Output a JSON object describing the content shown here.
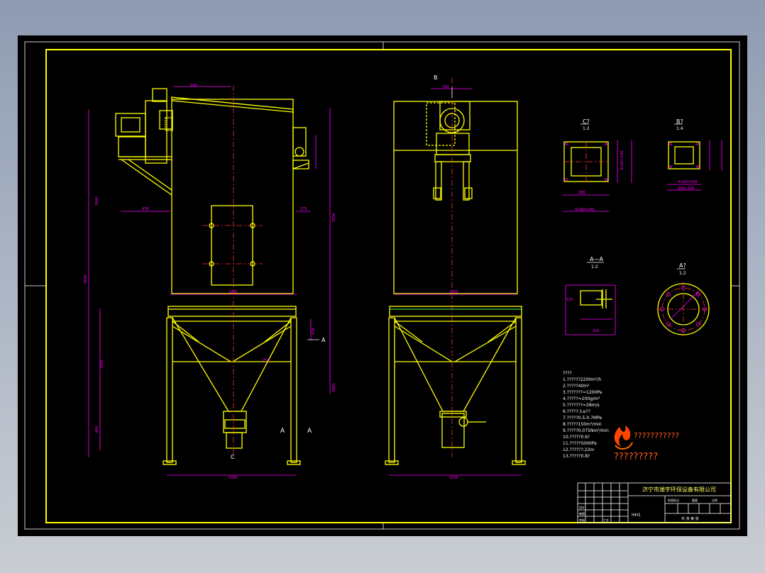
{
  "colors": {
    "background": "#000000",
    "outline": "#ffff00",
    "dimension": "#ff00ff",
    "centerline": "#ff3030",
    "text": "#ffffff",
    "frame": "#ffffff",
    "logo": "#ff4500"
  },
  "views": {
    "section_b_marker": "B",
    "section_c_marker": "C",
    "section_a_marker_left": "A",
    "section_a_marker_right": "A",
    "section_a_marker_side": "A",
    "detail_c_title": "C?",
    "detail_c_scale": "1:2",
    "detail_b_title": "B?",
    "detail_b_scale": "1:4",
    "detail_aa_title": "A—A",
    "detail_aa_scale": "1:2",
    "detail_a_title": "A?",
    "detail_a_scale": "1:2"
  },
  "notes": {
    "heading": "????",
    "lines": [
      "1.??????2200m³/h",
      "2.?????40m²",
      "3.???????=1200Pa",
      "4.?????=200g/m³",
      "5.???????=28m/s",
      "6.?????:1≤??",
      "7.?????0.5-0.7MPa",
      "8.?????150m³/min",
      "9.?????0.075Nm³/min",
      "10.?????0.6?",
      "11.?????5000Pa",
      "12.??????:22m",
      "13.?????0.8?"
    ]
  },
  "logo": {
    "line1": "???????????",
    "line2": "?????????"
  },
  "title_block": {
    "company": "济宁市潍宇环保设备有限公司",
    "drawing_code": "HH1",
    "row_labels": [
      "设计",
      "制图",
      "审核",
      "工艺"
    ],
    "stage_labels": [
      "阶段标记",
      "重量",
      "比例"
    ],
    "sheet_info": "共 张 第 张"
  }
}
